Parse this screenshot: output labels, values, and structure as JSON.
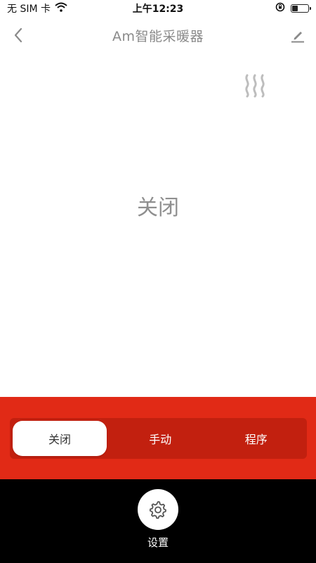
{
  "status_bar": {
    "carrier": "无 SIM 卡",
    "time": "上午12:23",
    "battery_level": 0.35
  },
  "nav": {
    "title": "Am智能采暖器",
    "back_icon": "chevron-left-icon",
    "edit_icon": "pencil-icon"
  },
  "heater": {
    "icon": "heat-waves-icon",
    "state_text": "关闭"
  },
  "modes": {
    "items": [
      {
        "label": "关闭",
        "active": true
      },
      {
        "label": "手动",
        "active": false
      },
      {
        "label": "程序",
        "active": false
      }
    ]
  },
  "footer": {
    "settings_icon": "gear-icon",
    "settings_label": "设置"
  },
  "colors": {
    "panel_red": "#e12a16",
    "segment_red": "#c2200f",
    "footer_black": "#000000",
    "title_gray": "#8a8a8a"
  }
}
